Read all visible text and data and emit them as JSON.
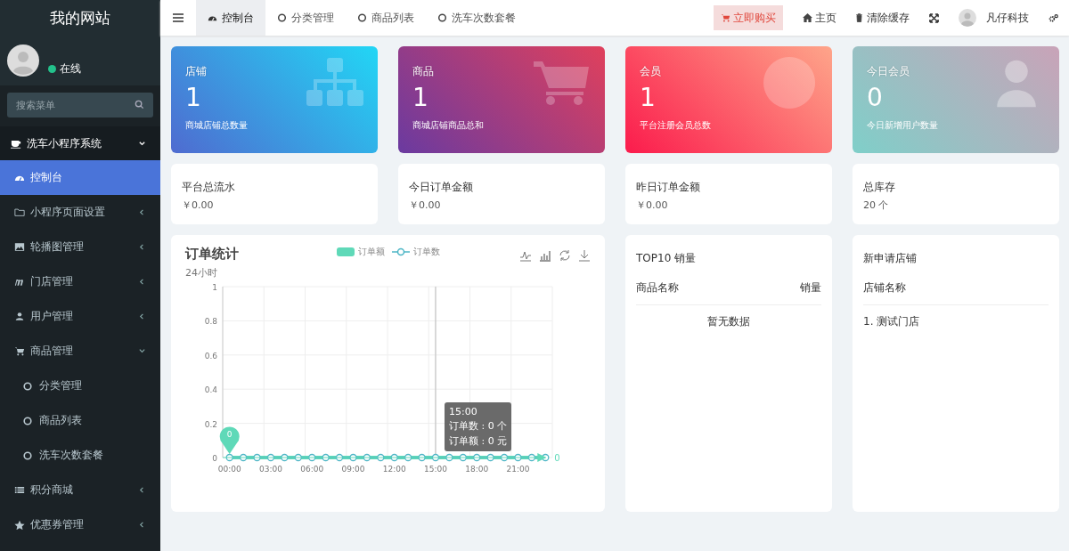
{
  "sidebar": {
    "site_title": "我的网站",
    "status": "在线",
    "search": {
      "placeholder": "搜索菜单"
    },
    "section": {
      "label": "洗车小程序系统",
      "expanded": true
    },
    "items": [
      {
        "label": "控制台",
        "selected": true
      },
      {
        "label": "小程序页面设置",
        "selected": false,
        "expanded": false
      },
      {
        "label": "轮播图管理",
        "selected": false,
        "expanded": false
      },
      {
        "label": "门店管理",
        "selected": false,
        "expanded": false
      },
      {
        "label": "用户管理",
        "selected": false,
        "expanded": false
      },
      {
        "label": "商品管理",
        "selected": false,
        "expanded": true,
        "children": [
          {
            "label": "分类管理",
            "selected": false
          },
          {
            "label": "商品列表",
            "selected": false
          },
          {
            "label": "洗车次数套餐",
            "selected": false
          }
        ]
      },
      {
        "label": "积分商城",
        "selected": false,
        "expanded": false
      },
      {
        "label": "优惠券管理",
        "selected": false,
        "expanded": false
      }
    ]
  },
  "tabs": [
    {
      "label": "控制台",
      "selected": true
    },
    {
      "label": "分类管理",
      "selected": false
    },
    {
      "label": "商品列表",
      "selected": false
    },
    {
      "label": "洗车次数套餐",
      "selected": false
    }
  ],
  "topbar": {
    "buy": "立即购买",
    "home": "主页",
    "clear_cache": "清除缓存",
    "user": "凡仔科技"
  },
  "stat_cards": [
    {
      "title": "店铺",
      "value": "1",
      "caption": "商城店铺总数量"
    },
    {
      "title": "商品",
      "value": "1",
      "caption": "商城店铺商品总和"
    },
    {
      "title": "会员",
      "value": "1",
      "caption": "平台注册会员总数"
    },
    {
      "title": "今日会员",
      "value": "0",
      "caption": "今日新增用户数量"
    }
  ],
  "info_cards": [
    {
      "label": "平台总流水",
      "value": "￥0.00"
    },
    {
      "label": "今日订单金额",
      "value": "￥0.00"
    },
    {
      "label": "昨日订单金额",
      "value": "￥0.00"
    },
    {
      "label": "总库存",
      "value": "20 个"
    }
  ],
  "order_chart": {
    "title": "订单统计",
    "subtitle": "24小时",
    "tooltip": {
      "title": "15:00",
      "lines": [
        "订单数 : 0 个",
        "订单额 : 0 元"
      ]
    },
    "chart_data": {
      "type": "line",
      "grid": true,
      "x": [
        0,
        1,
        2,
        3,
        4,
        5,
        6,
        7,
        8,
        9,
        10,
        11,
        12,
        13,
        14,
        15,
        16,
        17,
        18,
        19,
        20,
        21,
        22,
        23
      ],
      "xlim": [
        -0.5,
        23.5
      ],
      "xticks": [
        {
          "value": 0,
          "label": "00:00"
        },
        {
          "value": 3,
          "label": "03:00"
        },
        {
          "value": 6,
          "label": "06:00"
        },
        {
          "value": 9,
          "label": "09:00"
        },
        {
          "value": 12,
          "label": "12:00"
        },
        {
          "value": 15,
          "label": "15:00"
        },
        {
          "value": 18,
          "label": "18:00"
        },
        {
          "value": 21,
          "label": "21:00"
        }
      ],
      "ylim": [
        0,
        1
      ],
      "yticks": [
        0,
        0.2,
        0.4,
        0.6,
        0.8,
        1
      ],
      "series": [
        {
          "name": "订单额",
          "color": "#5fd9b8",
          "values": [
            0,
            0,
            0,
            0,
            0,
            0,
            0,
            0,
            0,
            0,
            0,
            0,
            0,
            0,
            0,
            0,
            0,
            0,
            0,
            0,
            0,
            0,
            0,
            0
          ]
        },
        {
          "name": "订单数",
          "color": "#4eb6c6",
          "marker": "circle",
          "values": [
            0,
            0,
            0,
            0,
            0,
            0,
            0,
            0,
            0,
            0,
            0,
            0,
            0,
            0,
            0,
            0,
            0,
            0,
            0,
            0,
            0,
            0,
            0,
            0
          ]
        }
      ],
      "ref_lines": [
        {
          "axis": "x",
          "value": 15
        },
        {
          "axis": "y",
          "value": 0,
          "label": "0"
        }
      ],
      "annotations": [
        {
          "text": "0",
          "x": 0,
          "y": 0
        }
      ]
    }
  },
  "top10": {
    "title": "TOP10 销量",
    "columns": [
      "商品名称",
      "销量"
    ],
    "empty": "暂无数据"
  },
  "new_stores": {
    "title": "新申请店铺",
    "column": "店铺名称",
    "rows": [
      "1. 测试门店"
    ]
  }
}
